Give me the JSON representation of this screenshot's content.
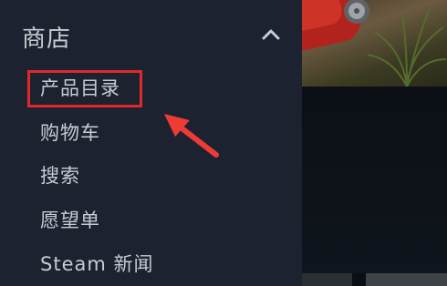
{
  "sidebar": {
    "section_title": "商店",
    "items": [
      {
        "label": "产品目录"
      },
      {
        "label": "购物车"
      },
      {
        "label": "搜索"
      },
      {
        "label": "愿望单"
      },
      {
        "label": "Steam 新闻"
      }
    ]
  },
  "colors": {
    "sidebar_bg": "#1c2230",
    "text": "#c7ccd3",
    "highlight": "#e0282b",
    "arrow": "#ef3b36"
  },
  "icons": {
    "collapse": "chevron-up-icon",
    "annotation": "red-arrow-icon"
  }
}
